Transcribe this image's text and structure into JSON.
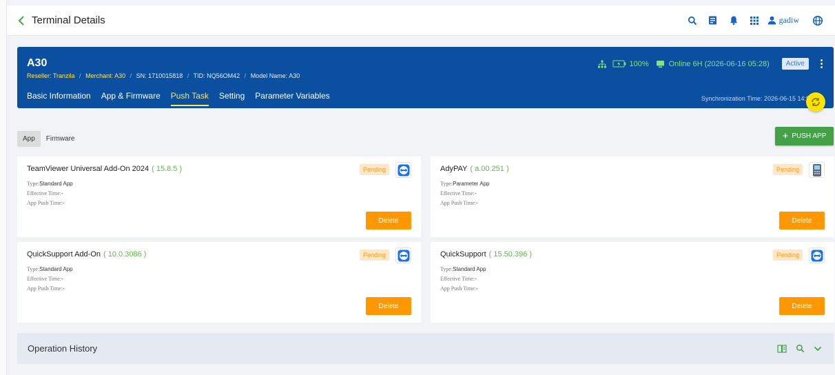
{
  "topbar": {
    "title": "Terminal Details",
    "username": "gadiw",
    "icons": [
      "back-icon",
      "search-icon",
      "news-icon",
      "bell-icon",
      "apps-grid-icon",
      "user-icon",
      "globe-icon"
    ]
  },
  "terminal": {
    "name": "A30",
    "reseller_label": "Reseller: Tranzila",
    "merchant_label": "Merchant: A30",
    "sn_label": "SN: 1710015818",
    "tid_label": "TID: NQ56OM42",
    "model_label": "Model Name: A30",
    "sep": "/",
    "battery": "100%",
    "online": "Online 6H (2026-06-16 05:28)",
    "status_badge": "Active",
    "sync_time": "Synchronization Time: 2026-06-15 14:59"
  },
  "tabs": [
    {
      "label": "Basic Information"
    },
    {
      "label": "App & Firmware"
    },
    {
      "label": "Push Task"
    },
    {
      "label": "Setting"
    },
    {
      "label": "Parameter Variables"
    }
  ],
  "subtabs": [
    {
      "label": "App"
    },
    {
      "label": "Firmware"
    }
  ],
  "push_button": {
    "plus": "+",
    "label": "PUSH APP"
  },
  "labels": {
    "type": "Type:",
    "effective": "Effective Time:",
    "pushtime": "App Push Time:",
    "pending": "Pending",
    "delete": "Delete"
  },
  "cards": [
    {
      "name": "TeamViewer Universal Add-On 2024",
      "version": "( 15.8.5 )",
      "type": "Standard App",
      "effective": "-",
      "push_time": "-",
      "icon": "teamviewer-icon"
    },
    {
      "name": "AdyPAY",
      "version": "( a.00.251 )",
      "type": "Parameter App",
      "effective": "-",
      "push_time": "-",
      "icon": "pos-terminal-icon"
    },
    {
      "name": "QuickSupport Add-On",
      "version": "( 10.0.3086 )",
      "type": "Standard App",
      "effective": "-",
      "push_time": "-",
      "icon": "teamviewer-icon"
    },
    {
      "name": "QuickSupport",
      "version": "( 15.50.396 )",
      "type": "Standard App",
      "effective": "-",
      "push_time": "-",
      "icon": "teamviewer-icon"
    }
  ],
  "history": {
    "title": "Operation History"
  },
  "colors": {
    "header_bg": "#0a4fa0",
    "accent_yellow": "#ffe55c",
    "online_green": "#7fe57f",
    "push_green": "#43a047",
    "delete_orange": "#ff9800",
    "version_green": "#5fb94a"
  }
}
